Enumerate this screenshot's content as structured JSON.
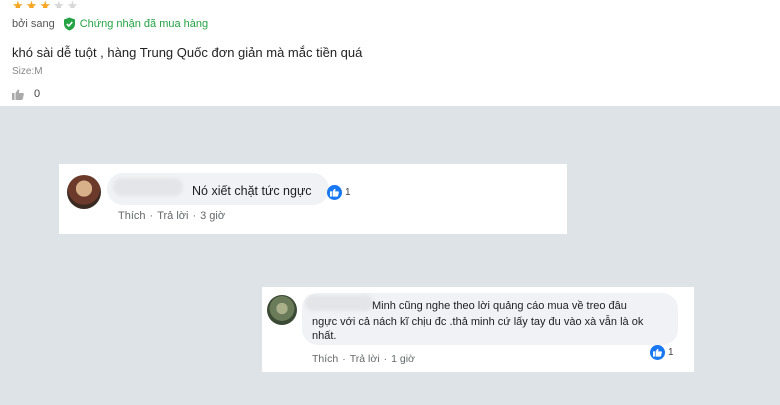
{
  "review": {
    "stars_filled": 3,
    "stars_total": 5,
    "author": "bởi sang",
    "verified_label": "Chứng nhận đã mua hàng",
    "text": "khó sài dễ tuột , hàng Trung Quốc đơn giản mà mắc tiền quá",
    "size": "Size:M",
    "like_count": "0"
  },
  "comment1": {
    "text": "Nó xiết chặt tức ngực",
    "reactions": "1",
    "like": "Thích",
    "reply": "Trả lời",
    "time": "3 giờ",
    "sep": "·"
  },
  "comment2": {
    "line1": "Minh cũng nghe theo lời quảng cáo mua về treo đâu",
    "line2": "ngực với cả nách kĩ chịu đc .thả minh cứ lấy tay đu vào xà vẫn là ok",
    "line3": "nhất.",
    "reactions": "1",
    "like": "Thích",
    "reply": "Trả lời",
    "time": "1 giờ",
    "sep": "·"
  },
  "colors": {
    "star": "#f5a623",
    "verified": "#25a244",
    "fb_blue": "#1877f2",
    "gray_bg": "#dde3e6"
  }
}
